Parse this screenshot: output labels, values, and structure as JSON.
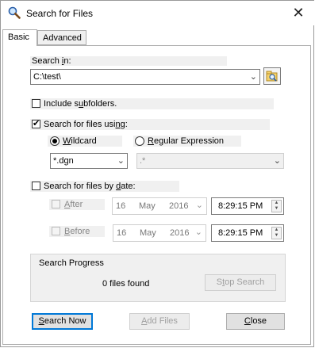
{
  "window": {
    "title": "Search for Files",
    "icon": "magnifier-icon",
    "close_glyph": "✕"
  },
  "tabs": [
    {
      "label": "Basic",
      "active": true
    },
    {
      "label": "Advanced",
      "active": false
    }
  ],
  "search_in": {
    "label_pre": "Search ",
    "label_u": "i",
    "label_post": "n:",
    "value": "C:\\test\\",
    "browse_icon": "folder-search-icon"
  },
  "include_subfolders": {
    "label_pre": "Include s",
    "label_u": "u",
    "label_post": "bfolders.",
    "checked": false
  },
  "search_for_files_using": {
    "label_pre": "Search for files usi",
    "label_u": "n",
    "label_post": "g:",
    "checked": true,
    "wildcard": {
      "label_u": "W",
      "label_post": "ildcard",
      "selected": true
    },
    "regex": {
      "label_u": "R",
      "label_post": "egular Expression",
      "selected": false
    },
    "wildcard_value": "*.dgn",
    "regex_value": ".*"
  },
  "search_by_date": {
    "label_pre": "Search for files by ",
    "label_u": "d",
    "label_post": "ate:",
    "checked": false,
    "after": {
      "label_u": "A",
      "label_post": "fter",
      "day": "16",
      "month": "May",
      "year": "2016",
      "time": "8:29:15 PM"
    },
    "before": {
      "label_u": "B",
      "label_post": "efore",
      "day": "16",
      "month": "May",
      "year": "2016",
      "time": "8:29:15 PM"
    }
  },
  "progress": {
    "title": "Search Progress",
    "status": "0 files found",
    "stop_pre": "S",
    "stop_u": "t",
    "stop_post": "op Search"
  },
  "buttons": {
    "search_now_u": "S",
    "search_now_post": "earch Now",
    "add_files_u": "A",
    "add_files_post": "dd Files",
    "close_u": "C",
    "close_post": "lose"
  }
}
